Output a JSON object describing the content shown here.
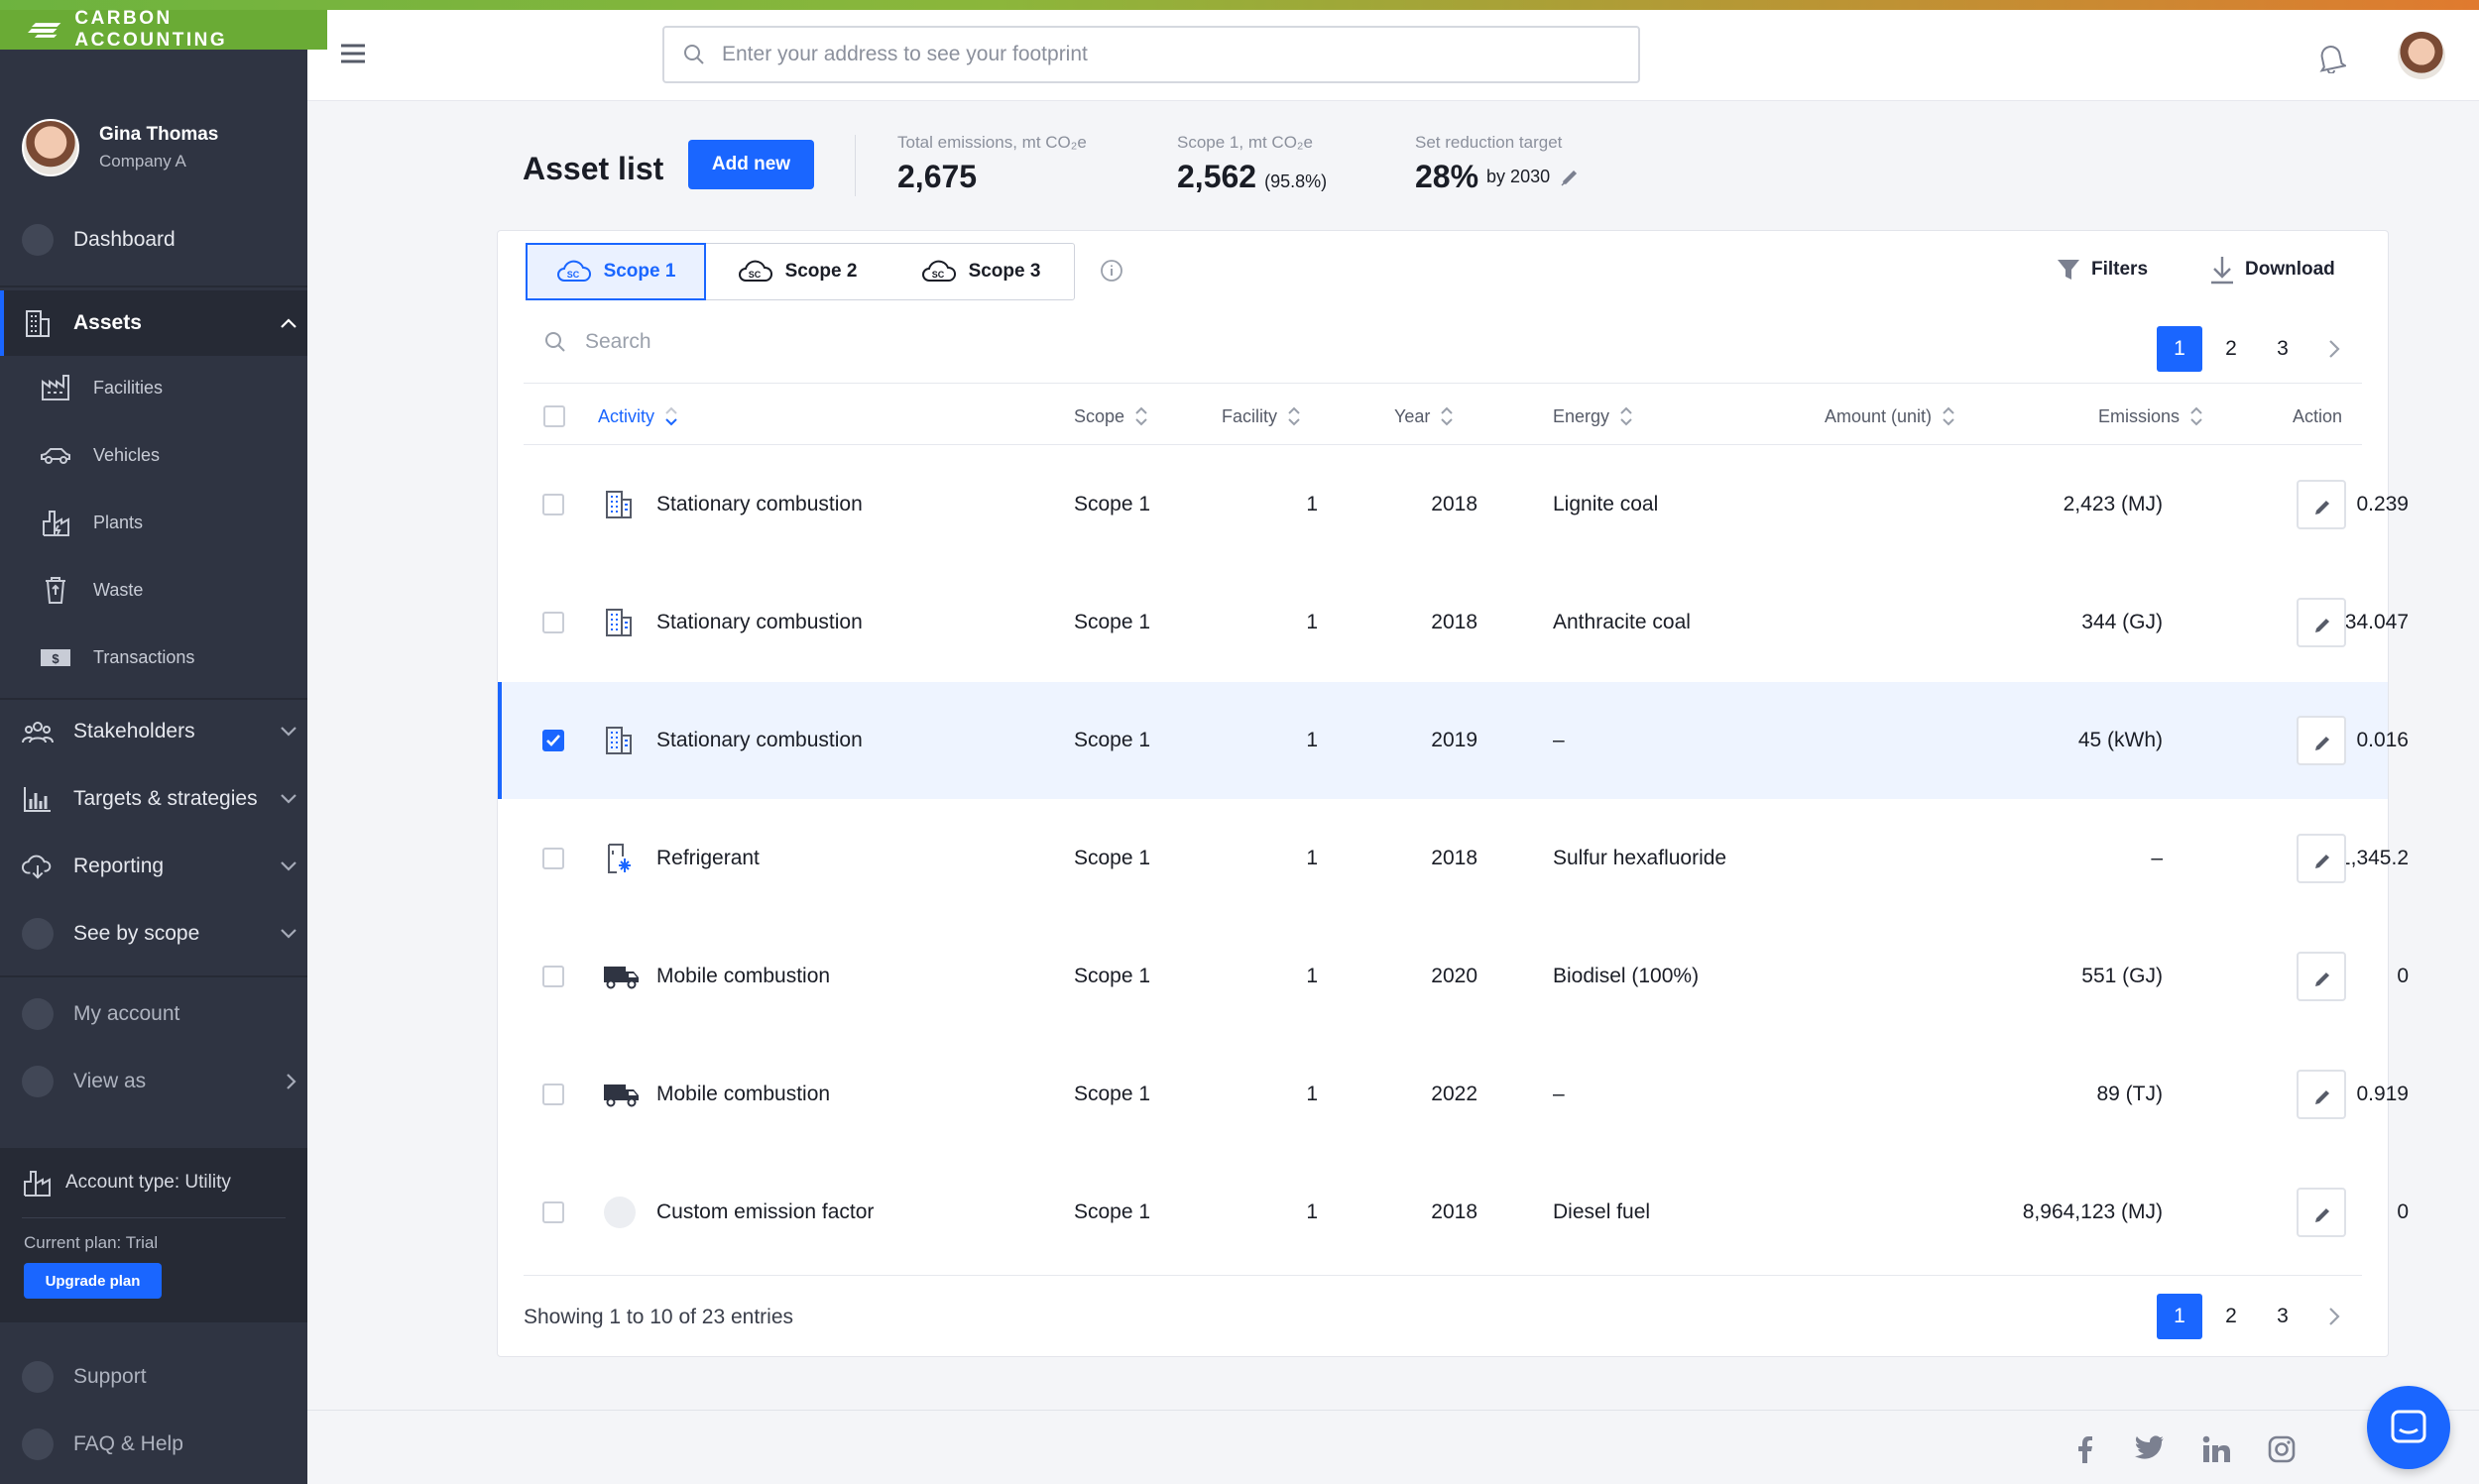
{
  "brand": {
    "name": "CARBON ACCOUNTING"
  },
  "user": {
    "name": "Gina Thomas",
    "company": "Company A"
  },
  "sidebar": {
    "dashboard": "Dashboard",
    "assets": "Assets",
    "assets_sub": [
      {
        "label": "Facilities",
        "icon": "factory-icon"
      },
      {
        "label": "Vehicles",
        "icon": "car-icon"
      },
      {
        "label": "Plants",
        "icon": "power-plant-icon"
      },
      {
        "label": "Waste",
        "icon": "recycle-bin-icon"
      },
      {
        "label": "Transactions",
        "icon": "dollar-bill-icon"
      }
    ],
    "stakeholders": "Stakeholders",
    "targets": "Targets & strategies",
    "reporting": "Reporting",
    "see_by_scope": "See by scope",
    "my_account": "My account",
    "view_as": "View as",
    "account_type": "Account type: Utility",
    "current_plan": "Current plan: Trial",
    "upgrade": "Upgrade plan",
    "support": "Support",
    "faq": "FAQ & Help"
  },
  "header": {
    "search_placeholder": "Enter your address to see your footprint"
  },
  "page": {
    "title": "Asset list",
    "add_new": "Add new",
    "stats": {
      "total_label": "Total emissions, mt CO₂e",
      "total_value": "2,675",
      "scope1_label": "Scope 1, mt CO₂e",
      "scope1_value": "2,562",
      "scope1_pct": "(95.8%)",
      "target_label": "Set reduction target",
      "target_value": "28%",
      "target_year": "by 2030"
    }
  },
  "tabs": [
    "Scope 1",
    "Scope 2",
    "Scope 3"
  ],
  "toolbar": {
    "filters": "Filters",
    "download": "Download",
    "search_placeholder": "Search"
  },
  "pagination": {
    "pages": [
      "1",
      "2",
      "3"
    ],
    "current": "1"
  },
  "table": {
    "columns": {
      "activity": "Activity",
      "scope": "Scope",
      "facility": "Facility",
      "year": "Year",
      "energy": "Energy",
      "amount": "Amount (unit)",
      "emissions": "Emissions",
      "action": "Action"
    },
    "rows": [
      {
        "activity": "Stationary combustion",
        "icon": "building-icon",
        "scope": "Scope 1",
        "facility": "1",
        "year": "2018",
        "energy": "Lignite coal",
        "amount": "2,423 (MJ)",
        "emissions": "0.239",
        "checked": false
      },
      {
        "activity": "Stationary combustion",
        "icon": "building-icon",
        "scope": "Scope 1",
        "facility": "1",
        "year": "2018",
        "energy": "Anthracite coal",
        "amount": "344 (GJ)",
        "emissions": "34.047",
        "checked": false
      },
      {
        "activity": "Stationary combustion",
        "icon": "building-icon",
        "scope": "Scope 1",
        "facility": "1",
        "year": "2019",
        "energy": "–",
        "amount": "45 (kWh)",
        "emissions": "0.016",
        "checked": true
      },
      {
        "activity": "Refrigerant",
        "icon": "refrigerant-icon",
        "scope": "Scope 1",
        "facility": "1",
        "year": "2018",
        "energy": "Sulfur hexafluoride",
        "amount": "–",
        "emissions": "-1,345.2",
        "checked": false
      },
      {
        "activity": "Mobile combustion",
        "icon": "truck-icon",
        "scope": "Scope 1",
        "facility": "1",
        "year": "2020",
        "energy": "Biodisel (100%)",
        "amount": "551 (GJ)",
        "emissions": "0",
        "checked": false
      },
      {
        "activity": "Mobile combustion",
        "icon": "truck-icon",
        "scope": "Scope 1",
        "facility": "1",
        "year": "2022",
        "energy": "–",
        "amount": "89 (TJ)",
        "emissions": "0.919",
        "checked": false
      },
      {
        "activity": "Custom emission factor",
        "icon": "placeholder-circle-icon",
        "scope": "Scope 1",
        "facility": "1",
        "year": "2018",
        "energy": "Diesel fuel",
        "amount": "8,964,123 (MJ)",
        "emissions": "0",
        "checked": false
      }
    ],
    "footer": "Showing 1 to 10 of 23 entries"
  },
  "social": [
    "facebook-icon",
    "twitter-icon",
    "linkedin-icon",
    "instagram-icon"
  ],
  "colors": {
    "accent": "#1a66ff",
    "sidebar": "#2f3442",
    "brand_green": "#6aab35",
    "selected_row": "#eef4ff"
  }
}
